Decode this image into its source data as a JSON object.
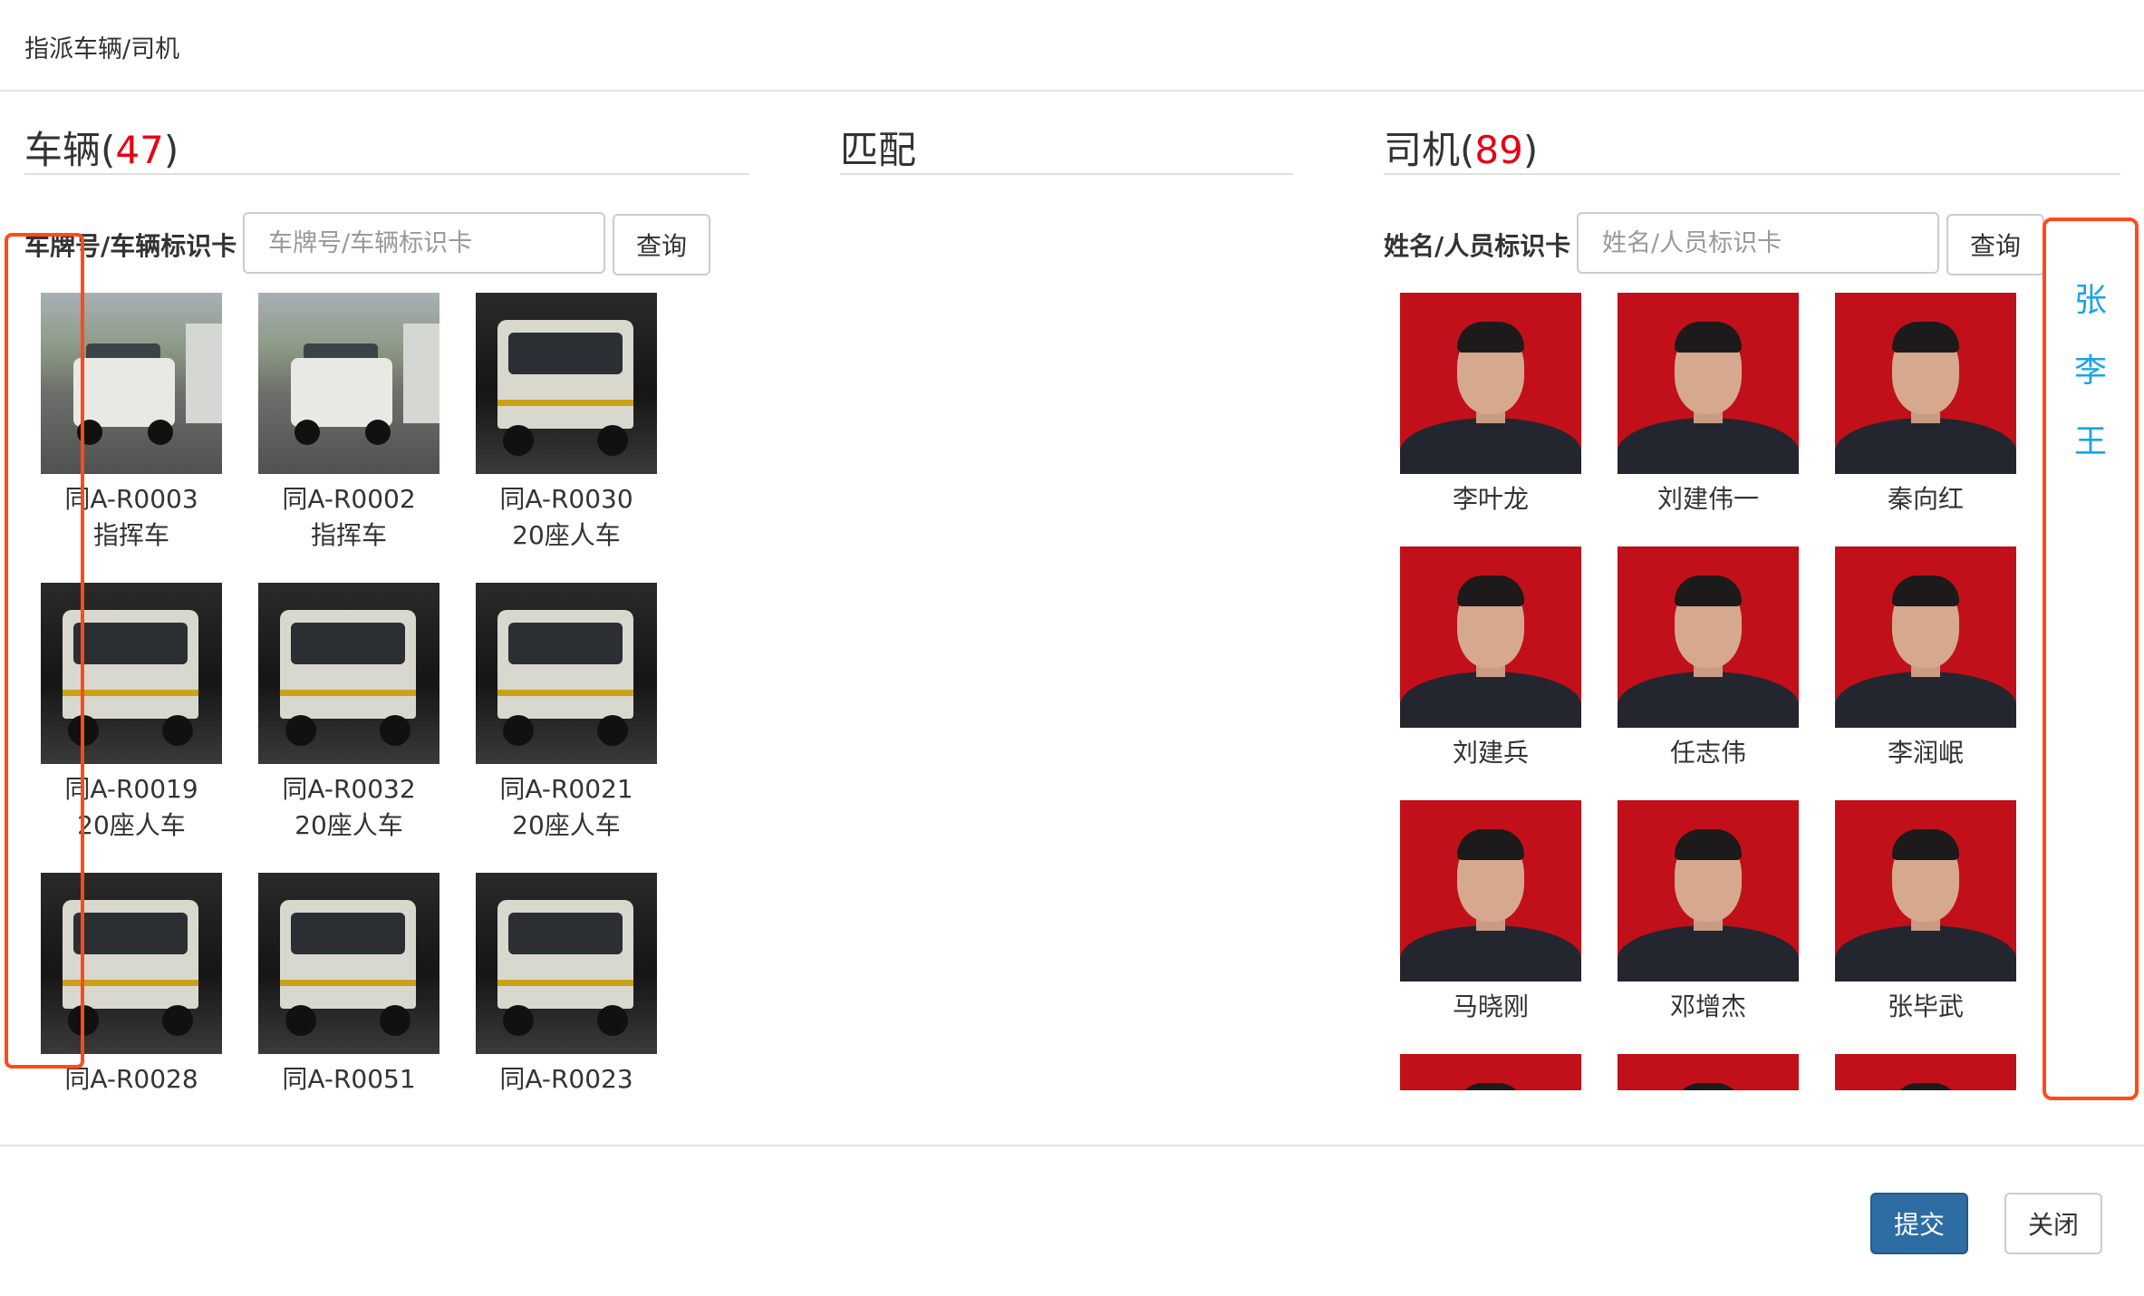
{
  "modal": {
    "title": "指派车辆/司机"
  },
  "vehicles": {
    "title": "车辆",
    "count": "47",
    "search_label": "车牌号/车辆标识卡",
    "search_placeholder": "车牌号/车辆标识卡",
    "search_button": "查询",
    "items": [
      {
        "plate": "同A-R0003",
        "type": "指挥车",
        "photo": "jeep"
      },
      {
        "plate": "同A-R0002",
        "type": "指挥车",
        "photo": "jeep"
      },
      {
        "plate": "同A-R0030",
        "type": "20座人车",
        "photo": "bus"
      },
      {
        "plate": "同A-R0019",
        "type": "20座人车",
        "photo": "bus"
      },
      {
        "plate": "同A-R0032",
        "type": "20座人车",
        "photo": "bus"
      },
      {
        "plate": "同A-R0021",
        "type": "20座人车",
        "photo": "bus"
      },
      {
        "plate": "同A-R0028",
        "type": "",
        "photo": "bus"
      },
      {
        "plate": "同A-R0051",
        "type": "",
        "photo": "bus"
      },
      {
        "plate": "同A-R0023",
        "type": "",
        "photo": "bus"
      }
    ]
  },
  "match": {
    "title": "匹配"
  },
  "drivers": {
    "title": "司机",
    "count": "89",
    "search_label": "姓名/人员标识卡",
    "search_placeholder": "姓名/人员标识卡",
    "search_button": "查询",
    "items": [
      {
        "name": "李叶龙"
      },
      {
        "name": "刘建伟一"
      },
      {
        "name": "秦向红"
      },
      {
        "name": "刘建兵"
      },
      {
        "name": "任志伟"
      },
      {
        "name": "李润岷"
      },
      {
        "name": "马晓刚"
      },
      {
        "name": "邓增杰"
      },
      {
        "name": "张毕武"
      },
      {
        "name": ""
      },
      {
        "name": ""
      },
      {
        "name": ""
      }
    ]
  },
  "surname_index": [
    "张",
    "李",
    "王"
  ],
  "footer": {
    "submit": "提交",
    "close": "关闭"
  },
  "colors": {
    "count": "#e60012",
    "index_link": "#1aa3e8",
    "highlight": "#ff4a1c",
    "primary": "#2e6da4"
  }
}
